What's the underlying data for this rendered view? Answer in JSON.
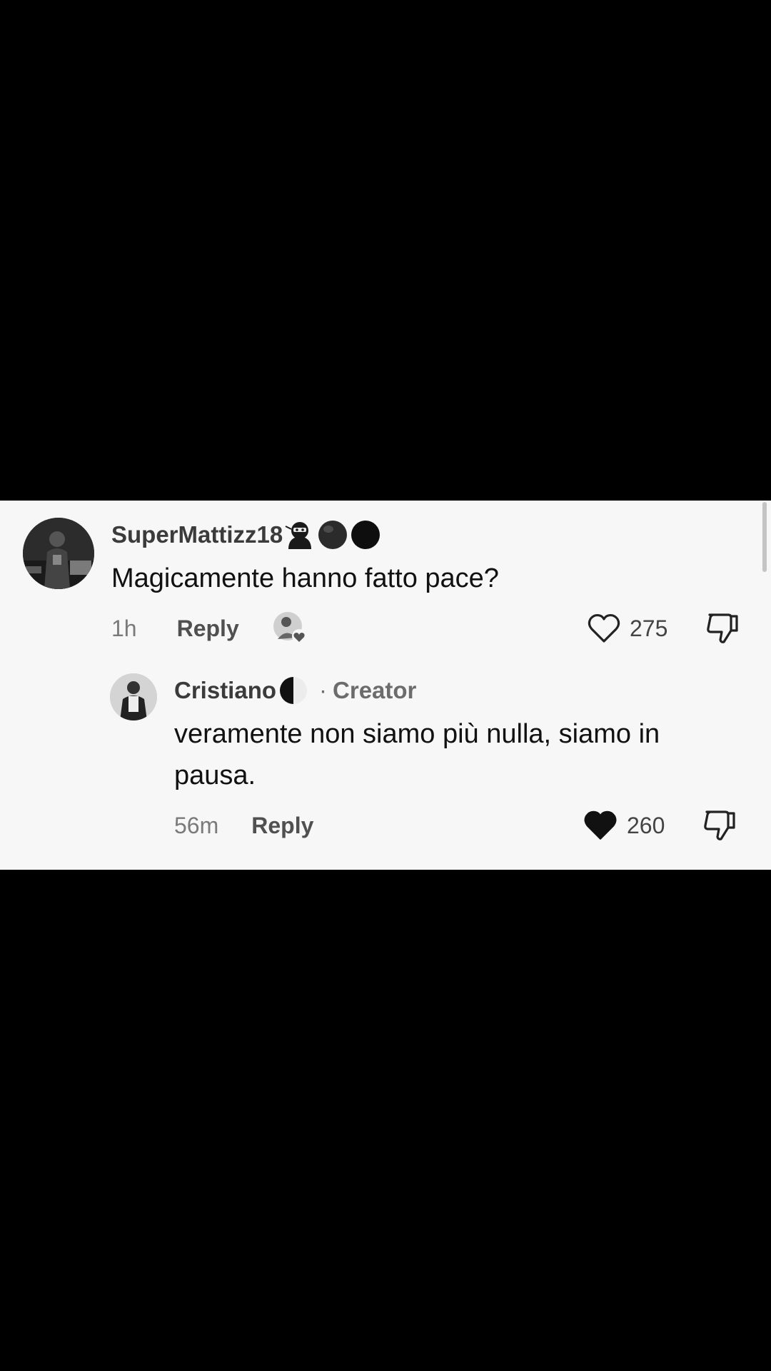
{
  "comments": [
    {
      "username": "SuperMattizz18",
      "text": "Magicamente hanno fatto pace?",
      "time": "1h",
      "reply_label": "Reply",
      "likes": "275",
      "liked_by_user": false
    },
    {
      "username": "Cristiano",
      "creator_separator": "·",
      "creator_label": "Creator",
      "text": "veramente non siamo più nulla, siamo in pausa.",
      "time": "56m",
      "reply_label": "Reply",
      "likes": "260",
      "liked_by_user": true
    }
  ],
  "colors": {
    "background_outer": "#000000",
    "panel_bg": "#f7f7f7",
    "username": "#3b3b3b",
    "text": "#111111",
    "meta": "#777777"
  },
  "icons": {
    "username_emojis": [
      "ninja-emoji-icon",
      "black-circle-icon",
      "black-circle-icon"
    ],
    "creator_emoji": "half-moon-icon",
    "like": "heart-icon",
    "dislike": "thumbs-down-icon"
  }
}
